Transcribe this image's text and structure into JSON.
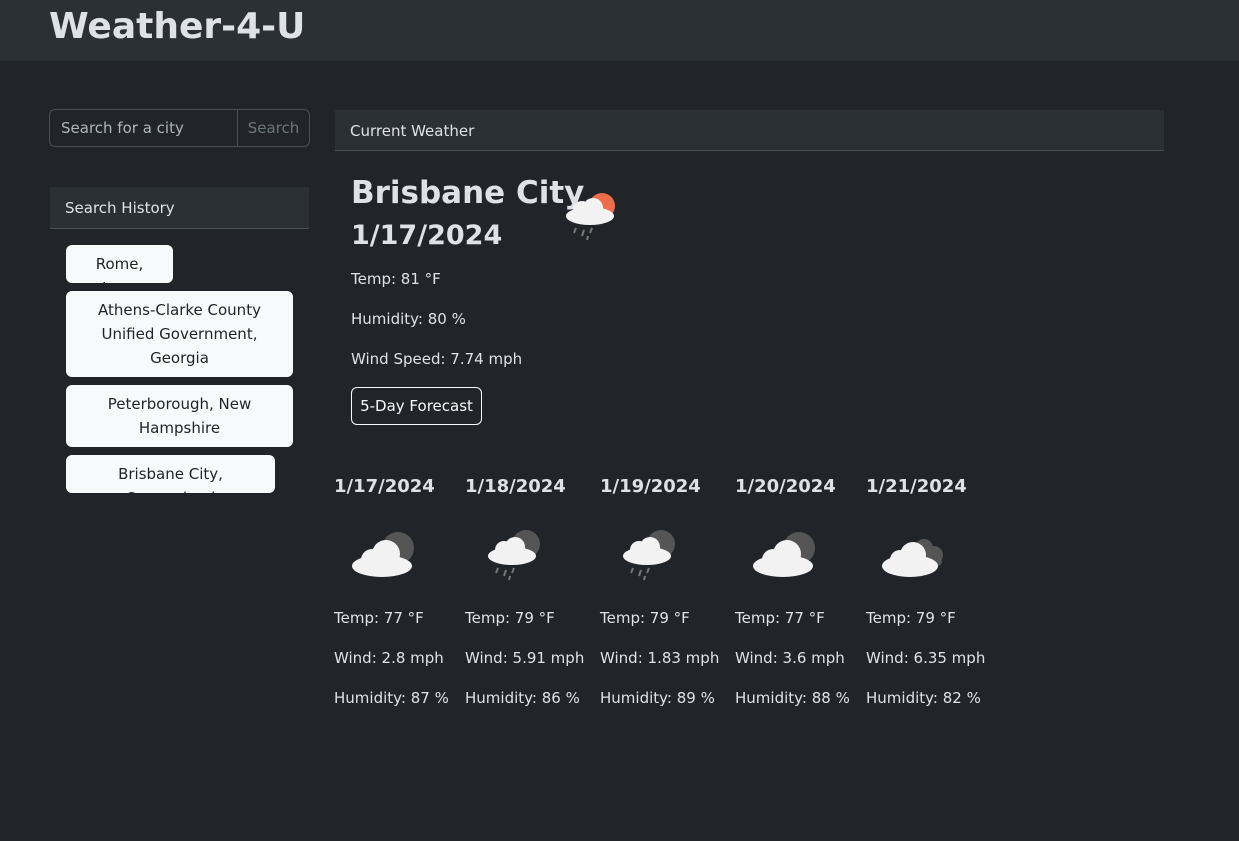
{
  "app": {
    "title": "Weather-4-U"
  },
  "search": {
    "placeholder": "Search for a city",
    "button_label": "Search"
  },
  "history": {
    "title": "Search History",
    "items": [
      "Rome, Iowa",
      "Athens-Clarke County Unified Government, Georgia",
      "Peterborough, New Hampshire",
      "Brisbane City, Queensland"
    ]
  },
  "current": {
    "header": "Current Weather",
    "city": "Brisbane City",
    "date": "1/17/2024",
    "icon": "sun-cloud-rain-icon",
    "temp": "Temp: 81 °F",
    "humidity": "Humidity: 80 %",
    "wind": "Wind Speed: 7.74 mph",
    "forecast_button": "5-Day Forecast"
  },
  "forecast": [
    {
      "date": "1/17/2024",
      "icon": "moon-cloud-icon",
      "temp": "Temp: 77 °F",
      "wind": "Wind: 2.8 mph",
      "humidity": "Humidity: 87 %"
    },
    {
      "date": "1/18/2024",
      "icon": "moon-cloud-rain-icon",
      "temp": "Temp: 79 °F",
      "wind": "Wind: 5.91 mph",
      "humidity": "Humidity: 86 %"
    },
    {
      "date": "1/19/2024",
      "icon": "moon-cloud-rain-icon",
      "temp": "Temp: 79 °F",
      "wind": "Wind: 1.83 mph",
      "humidity": "Humidity: 89 %"
    },
    {
      "date": "1/20/2024",
      "icon": "moon-cloud-icon",
      "temp": "Temp: 77 °F",
      "wind": "Wind: 3.6 mph",
      "humidity": "Humidity: 88 %"
    },
    {
      "date": "1/21/2024",
      "icon": "broken-clouds-icon",
      "temp": "Temp: 79 °F",
      "wind": "Wind: 6.35 mph",
      "humidity": "Humidity: 82 %"
    }
  ],
  "colors": {
    "background": "#212529",
    "navbar": "#2b3035",
    "sun": "#ee6e4c",
    "cloud": "#f2f2f2",
    "moon": "#555555"
  }
}
